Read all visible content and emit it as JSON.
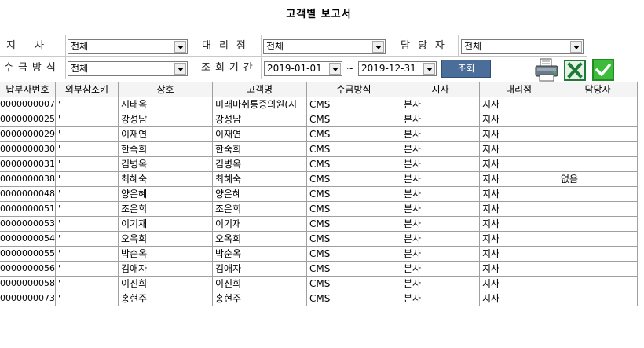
{
  "title": "고객별 보고서",
  "filters": {
    "branch_label": "지 사",
    "branch_value": "전체",
    "agency_label": "대리점",
    "agency_value": "전체",
    "manager_label": "담당자",
    "manager_value": "전체",
    "payment_label": "수금방식",
    "payment_value": "전체",
    "period_label": "조회기간",
    "date_from": "2019-01-01",
    "range_sep": "~",
    "date_to": "2019-12-31",
    "search_label": "조회"
  },
  "toolbar": {
    "icons": [
      "printer-icon",
      "excel-icon",
      "check-icon"
    ]
  },
  "table": {
    "columns": [
      "납부자번호",
      "외부참조키",
      "상호",
      "고객명",
      "수금방식",
      "지사",
      "대리점",
      "담당자"
    ],
    "rows": [
      [
        "0000000007",
        "'",
        "시태옥",
        "미래마취통증의원(시",
        "CMS",
        "본사",
        "지사",
        ""
      ],
      [
        "0000000025",
        "'",
        "강성남",
        "강성남",
        "CMS",
        "본사",
        "지사",
        ""
      ],
      [
        "0000000029",
        "'",
        "이재연",
        "이재연",
        "CMS",
        "본사",
        "지사",
        ""
      ],
      [
        "0000000030",
        "'",
        "한숙희",
        "한숙희",
        "CMS",
        "본사",
        "지사",
        ""
      ],
      [
        "0000000031",
        "'",
        "김병옥",
        "김병옥",
        "CMS",
        "본사",
        "지사",
        ""
      ],
      [
        "0000000038",
        "'",
        "최혜숙",
        "최혜숙",
        "CMS",
        "본사",
        "지사",
        "없음"
      ],
      [
        "0000000048",
        "'",
        "양은혜",
        "양은혜",
        "CMS",
        "본사",
        "지사",
        ""
      ],
      [
        "0000000051",
        "'",
        "조은희",
        "조은희",
        "CMS",
        "본사",
        "지사",
        ""
      ],
      [
        "0000000053",
        "'",
        "이기재",
        "이기재",
        "CMS",
        "본사",
        "지사",
        ""
      ],
      [
        "0000000054",
        "'",
        "오옥희",
        "오옥희",
        "CMS",
        "본사",
        "지사",
        ""
      ],
      [
        "0000000055",
        "'",
        "박순옥",
        "박순옥",
        "CMS",
        "본사",
        "지사",
        ""
      ],
      [
        "0000000056",
        "'",
        "김애자",
        "김애자",
        "CMS",
        "본사",
        "지사",
        ""
      ],
      [
        "0000000058",
        "'",
        "이진희",
        "이진희",
        "CMS",
        "본사",
        "지사",
        ""
      ],
      [
        "0000000073",
        "'",
        "홍현주",
        "홍현주",
        "CMS",
        "본사",
        "지사",
        ""
      ]
    ]
  }
}
